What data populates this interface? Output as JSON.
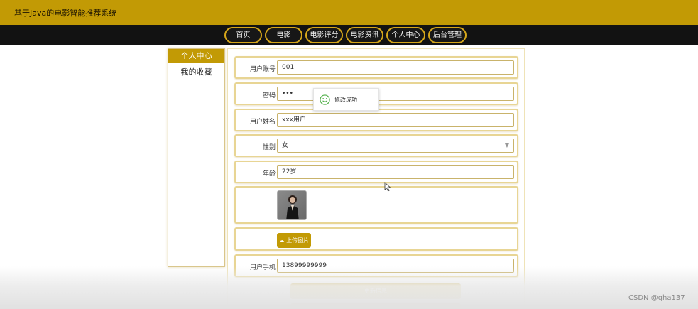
{
  "app": {
    "title": "基于Java的电影智能推荐系统"
  },
  "nav": {
    "items": [
      {
        "label": "首页"
      },
      {
        "label": "电影"
      },
      {
        "label": "电影评分"
      },
      {
        "label": "电影资讯"
      },
      {
        "label": "个人中心"
      },
      {
        "label": "后台管理"
      }
    ]
  },
  "sidebar": {
    "items": [
      {
        "label": "个人中心",
        "active": true
      },
      {
        "label": "我的收藏",
        "active": false
      }
    ]
  },
  "form": {
    "account": {
      "label": "用户账号",
      "value": "001"
    },
    "password": {
      "label": "密码",
      "value": "•••"
    },
    "name": {
      "label": "用户姓名",
      "value": "xxx用户"
    },
    "gender": {
      "label": "性别",
      "value": "女"
    },
    "age": {
      "label": "年龄",
      "value": "22岁"
    },
    "upload_label": "上传图片",
    "phone": {
      "label": "用户手机",
      "value": "13899999999"
    }
  },
  "actions": {
    "update_label": "更新信息",
    "second_label": ""
  },
  "toast": {
    "message": "修改成功"
  },
  "watermark": "CSDN @qha137",
  "colors": {
    "accent": "#c29a05",
    "nav_bg": "#121212",
    "nav_border": "#d6a71a"
  }
}
